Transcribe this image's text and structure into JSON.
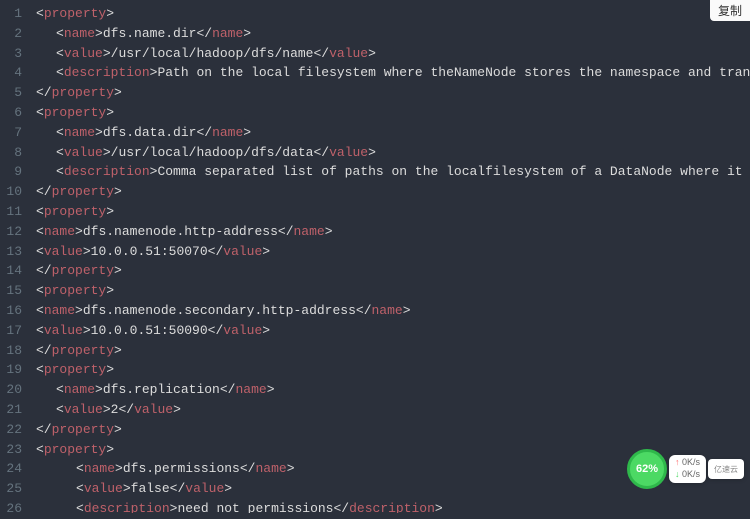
{
  "copy_label": "复制",
  "percentage": "62%",
  "stats": {
    "up": "0K/s",
    "down": "0K/s"
  },
  "logo": "亿速云",
  "lines": [
    {
      "indent": 0,
      "parts": [
        {
          "t": "b",
          "v": "<"
        },
        {
          "t": "tag",
          "v": "property"
        },
        {
          "t": "b",
          "v": ">"
        }
      ]
    },
    {
      "indent": 1,
      "parts": [
        {
          "t": "b",
          "v": "<"
        },
        {
          "t": "tag",
          "v": "name"
        },
        {
          "t": "b",
          "v": ">"
        },
        {
          "t": "txt",
          "v": "dfs.name.dir"
        },
        {
          "t": "b",
          "v": "</"
        },
        {
          "t": "tag",
          "v": "name"
        },
        {
          "t": "b",
          "v": ">"
        }
      ]
    },
    {
      "indent": 1,
      "parts": [
        {
          "t": "b",
          "v": "<"
        },
        {
          "t": "tag",
          "v": "value"
        },
        {
          "t": "b",
          "v": ">"
        },
        {
          "t": "txt",
          "v": "/usr/local/hadoop/dfs/name"
        },
        {
          "t": "b",
          "v": "</"
        },
        {
          "t": "tag",
          "v": "value"
        },
        {
          "t": "b",
          "v": ">"
        }
      ]
    },
    {
      "indent": 1,
      "parts": [
        {
          "t": "b",
          "v": "<"
        },
        {
          "t": "tag",
          "v": "description"
        },
        {
          "t": "b",
          "v": ">"
        },
        {
          "t": "txt",
          "v": "Path on the local filesystem where theNameNode stores the namespace and transactions lo"
        }
      ]
    },
    {
      "indent": 0,
      "parts": [
        {
          "t": "b",
          "v": "</"
        },
        {
          "t": "tag",
          "v": "property"
        },
        {
          "t": "b",
          "v": ">"
        }
      ]
    },
    {
      "indent": 0,
      "parts": [
        {
          "t": "b",
          "v": "<"
        },
        {
          "t": "tag",
          "v": "property"
        },
        {
          "t": "b",
          "v": ">"
        }
      ]
    },
    {
      "indent": 1,
      "parts": [
        {
          "t": "b",
          "v": "<"
        },
        {
          "t": "tag",
          "v": "name"
        },
        {
          "t": "b",
          "v": ">"
        },
        {
          "t": "txt",
          "v": "dfs.data.dir"
        },
        {
          "t": "b",
          "v": "</"
        },
        {
          "t": "tag",
          "v": "name"
        },
        {
          "t": "b",
          "v": ">"
        }
      ]
    },
    {
      "indent": 1,
      "parts": [
        {
          "t": "b",
          "v": "<"
        },
        {
          "t": "tag",
          "v": "value"
        },
        {
          "t": "b",
          "v": ">"
        },
        {
          "t": "txt",
          "v": "/usr/local/hadoop/dfs/data"
        },
        {
          "t": "b",
          "v": "</"
        },
        {
          "t": "tag",
          "v": "value"
        },
        {
          "t": "b",
          "v": ">"
        }
      ]
    },
    {
      "indent": 1,
      "parts": [
        {
          "t": "b",
          "v": "<"
        },
        {
          "t": "tag",
          "v": "description"
        },
        {
          "t": "b",
          "v": ">"
        },
        {
          "t": "txt",
          "v": "Comma separated list of paths on the localfilesystem of a DataNode where it should stor"
        }
      ]
    },
    {
      "indent": 0,
      "parts": [
        {
          "t": "b",
          "v": "</"
        },
        {
          "t": "tag",
          "v": "property"
        },
        {
          "t": "b",
          "v": ">"
        }
      ]
    },
    {
      "indent": 0,
      "parts": [
        {
          "t": "b",
          "v": "<"
        },
        {
          "t": "tag",
          "v": "property"
        },
        {
          "t": "b",
          "v": ">"
        }
      ]
    },
    {
      "indent": 0,
      "parts": [
        {
          "t": "b",
          "v": "<"
        },
        {
          "t": "tag",
          "v": "name"
        },
        {
          "t": "b",
          "v": ">"
        },
        {
          "t": "txt",
          "v": "dfs.namenode.http-address"
        },
        {
          "t": "b",
          "v": "</"
        },
        {
          "t": "tag",
          "v": "name"
        },
        {
          "t": "b",
          "v": ">"
        }
      ]
    },
    {
      "indent": 0,
      "parts": [
        {
          "t": "b",
          "v": "<"
        },
        {
          "t": "tag",
          "v": "value"
        },
        {
          "t": "b",
          "v": ">"
        },
        {
          "t": "txt",
          "v": "10.0.0.51:50070"
        },
        {
          "t": "b",
          "v": "</"
        },
        {
          "t": "tag",
          "v": "value"
        },
        {
          "t": "b",
          "v": ">"
        }
      ]
    },
    {
      "indent": 0,
      "parts": [
        {
          "t": "b",
          "v": "</"
        },
        {
          "t": "tag",
          "v": "property"
        },
        {
          "t": "b",
          "v": ">"
        }
      ]
    },
    {
      "indent": 0,
      "parts": [
        {
          "t": "b",
          "v": "<"
        },
        {
          "t": "tag",
          "v": "property"
        },
        {
          "t": "b",
          "v": ">"
        }
      ]
    },
    {
      "indent": 0,
      "parts": [
        {
          "t": "b",
          "v": "<"
        },
        {
          "t": "tag",
          "v": "name"
        },
        {
          "t": "b",
          "v": ">"
        },
        {
          "t": "txt",
          "v": "dfs.namenode.secondary.http-address"
        },
        {
          "t": "b",
          "v": "</"
        },
        {
          "t": "tag",
          "v": "name"
        },
        {
          "t": "b",
          "v": ">"
        }
      ]
    },
    {
      "indent": 0,
      "parts": [
        {
          "t": "b",
          "v": "<"
        },
        {
          "t": "tag",
          "v": "value"
        },
        {
          "t": "b",
          "v": ">"
        },
        {
          "t": "txt",
          "v": "10.0.0.51:50090"
        },
        {
          "t": "b",
          "v": "</"
        },
        {
          "t": "tag",
          "v": "value"
        },
        {
          "t": "b",
          "v": ">"
        }
      ]
    },
    {
      "indent": 0,
      "parts": [
        {
          "t": "b",
          "v": "</"
        },
        {
          "t": "tag",
          "v": "property"
        },
        {
          "t": "b",
          "v": ">"
        }
      ]
    },
    {
      "indent": 0,
      "parts": [
        {
          "t": "b",
          "v": "<"
        },
        {
          "t": "tag",
          "v": "property"
        },
        {
          "t": "b",
          "v": ">"
        }
      ]
    },
    {
      "indent": 1,
      "parts": [
        {
          "t": "b",
          "v": "<"
        },
        {
          "t": "tag",
          "v": "name"
        },
        {
          "t": "b",
          "v": ">"
        },
        {
          "t": "txt",
          "v": "dfs.replication"
        },
        {
          "t": "b",
          "v": "</"
        },
        {
          "t": "tag",
          "v": "name"
        },
        {
          "t": "b",
          "v": ">"
        }
      ]
    },
    {
      "indent": 1,
      "parts": [
        {
          "t": "b",
          "v": "<"
        },
        {
          "t": "tag",
          "v": "value"
        },
        {
          "t": "b",
          "v": ">"
        },
        {
          "t": "txt",
          "v": "2"
        },
        {
          "t": "b",
          "v": "</"
        },
        {
          "t": "tag",
          "v": "value"
        },
        {
          "t": "b",
          "v": ">"
        }
      ]
    },
    {
      "indent": 0,
      "parts": [
        {
          "t": "b",
          "v": "</"
        },
        {
          "t": "tag",
          "v": "property"
        },
        {
          "t": "b",
          "v": ">"
        }
      ]
    },
    {
      "indent": 0,
      "parts": [
        {
          "t": "b",
          "v": "<"
        },
        {
          "t": "tag",
          "v": "property"
        },
        {
          "t": "b",
          "v": ">"
        }
      ]
    },
    {
      "indent": 2,
      "parts": [
        {
          "t": "b",
          "v": "<"
        },
        {
          "t": "tag",
          "v": "name"
        },
        {
          "t": "b",
          "v": ">"
        },
        {
          "t": "txt",
          "v": "dfs.permissions"
        },
        {
          "t": "b",
          "v": "</"
        },
        {
          "t": "tag",
          "v": "name"
        },
        {
          "t": "b",
          "v": ">"
        }
      ]
    },
    {
      "indent": 2,
      "parts": [
        {
          "t": "b",
          "v": "<"
        },
        {
          "t": "tag",
          "v": "value"
        },
        {
          "t": "b",
          "v": ">"
        },
        {
          "t": "txt",
          "v": "false"
        },
        {
          "t": "b",
          "v": "</"
        },
        {
          "t": "tag",
          "v": "value"
        },
        {
          "t": "b",
          "v": ">"
        }
      ]
    },
    {
      "indent": 2,
      "parts": [
        {
          "t": "b",
          "v": "<"
        },
        {
          "t": "tag",
          "v": "description"
        },
        {
          "t": "b",
          "v": ">"
        },
        {
          "t": "txt",
          "v": "need not permissions"
        },
        {
          "t": "b",
          "v": "</"
        },
        {
          "t": "tag",
          "v": "description"
        },
        {
          "t": "b",
          "v": ">"
        }
      ]
    }
  ]
}
